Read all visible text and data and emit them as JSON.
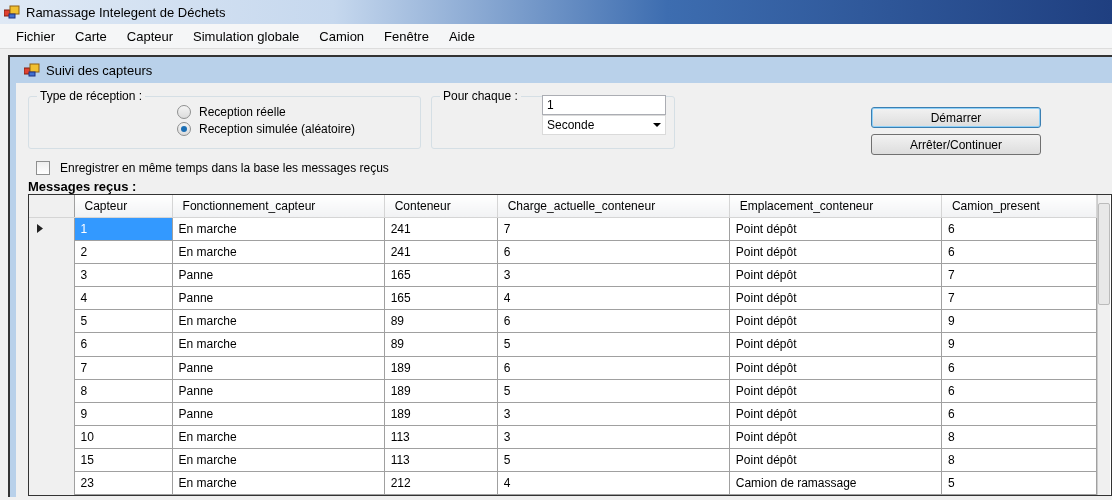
{
  "window": {
    "title": "Ramassage Intelegent de Déchets"
  },
  "menu": [
    "Fichier",
    "Carte",
    "Capteur",
    "Simulation globale",
    "Camion",
    "Fenêtre",
    "Aide"
  ],
  "child_window": {
    "title": "Suivi des capteurs"
  },
  "reception_group": {
    "label": "Type de réception :",
    "options": [
      {
        "label": "Reception réelle",
        "selected": false
      },
      {
        "label": "Reception simulée (aléatoire)",
        "selected": true
      }
    ]
  },
  "interval_group": {
    "label": "Pour chaque :",
    "value": "1",
    "unit": "Seconde"
  },
  "buttons": [
    {
      "label": "Démarrer",
      "focused": true
    },
    {
      "label": "Arrêter/Continuer",
      "focused": false
    }
  ],
  "save_checkbox": {
    "label": "Enregistrer en même temps dans la base les messages reçus",
    "checked": false
  },
  "table": {
    "title": "Messages reçus :",
    "columns": [
      "Capteur",
      "Fonctionnement_capteur",
      "Conteneur",
      "Charge_actuelle_conteneur",
      "Emplacement_conteneur",
      "Camion_present"
    ],
    "rows": [
      {
        "selected": true,
        "cells": [
          "1",
          "En marche",
          "241",
          "7",
          "Point dépôt",
          "6"
        ]
      },
      {
        "selected": false,
        "cells": [
          "2",
          "En marche",
          "241",
          "6",
          "Point dépôt",
          "6"
        ]
      },
      {
        "selected": false,
        "cells": [
          "3",
          "Panne",
          "165",
          "3",
          "Point dépôt",
          "7"
        ]
      },
      {
        "selected": false,
        "cells": [
          "4",
          "Panne",
          "165",
          "4",
          "Point dépôt",
          "7"
        ]
      },
      {
        "selected": false,
        "cells": [
          "5",
          "En marche",
          "89",
          "6",
          "Point dépôt",
          "9"
        ]
      },
      {
        "selected": false,
        "cells": [
          "6",
          "En marche",
          "89",
          "5",
          "Point dépôt",
          "9"
        ]
      },
      {
        "selected": false,
        "cells": [
          "7",
          "Panne",
          "189",
          "6",
          "Point dépôt",
          "6"
        ]
      },
      {
        "selected": false,
        "cells": [
          "8",
          "Panne",
          "189",
          "5",
          "Point dépôt",
          "6"
        ]
      },
      {
        "selected": false,
        "cells": [
          "9",
          "Panne",
          "189",
          "3",
          "Point dépôt",
          "6"
        ]
      },
      {
        "selected": false,
        "cells": [
          "10",
          "En marche",
          "113",
          "3",
          "Point dépôt",
          "8"
        ]
      },
      {
        "selected": false,
        "cells": [
          "15",
          "En marche",
          "113",
          "5",
          "Point dépôt",
          "8"
        ]
      },
      {
        "selected": false,
        "cells": [
          "23",
          "En marche",
          "212",
          "4",
          "Camion de ramassage",
          "5"
        ]
      }
    ]
  }
}
